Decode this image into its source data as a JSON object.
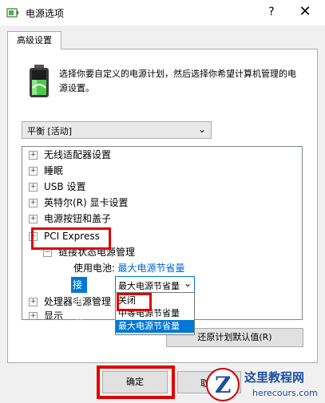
{
  "window": {
    "title": "电源选项",
    "help_glyph": "?",
    "close_glyph": "✕",
    "icon": "power-options-icon"
  },
  "tab": {
    "label": "高级设置"
  },
  "description": "选择你要自定义的电源计划，然后选择你希望计算机管理的电源设置。",
  "plan_select": {
    "value": "平衡 [活动]",
    "arrow": "⌄"
  },
  "tree": {
    "items": [
      {
        "label": "无线适配器设置",
        "exp": "+"
      },
      {
        "label": "睡眠",
        "exp": "+"
      },
      {
        "label": "USB 设置",
        "exp": "+"
      },
      {
        "label": "英特尔(R) 显卡设置",
        "exp": "+"
      },
      {
        "label": "电源按钮和盖子",
        "exp": "+"
      },
      {
        "label": "PCI Express",
        "exp": "−"
      },
      {
        "label": "链接状态电源管理",
        "exp": "−"
      },
      {
        "label": "处理器电源管理",
        "exp": "+"
      },
      {
        "label": "显示",
        "exp": "+"
      }
    ],
    "battery": {
      "label": "使用电池:",
      "value": "最大电源节省量"
    },
    "plugged_in": {
      "label": "接通电源:",
      "value": "最大电源节省量",
      "arrow": "⌄"
    },
    "scroll_up": "▲",
    "scroll_down": "▼"
  },
  "dropdown": {
    "options": [
      "关闭",
      "中等电源节省量",
      "最大电源节省量"
    ],
    "selected_index": 2
  },
  "restore_button": "还原计划默认值(R)",
  "ok_button": "确定",
  "cancel_button": "取",
  "watermark": {
    "title": "这里教程网",
    "url": "herecours.com",
    "logo_letter": "Z"
  },
  "colors": {
    "highlight_red": "#e00000",
    "accent_blue": "#0078d7",
    "link_blue": "#0066cc"
  }
}
